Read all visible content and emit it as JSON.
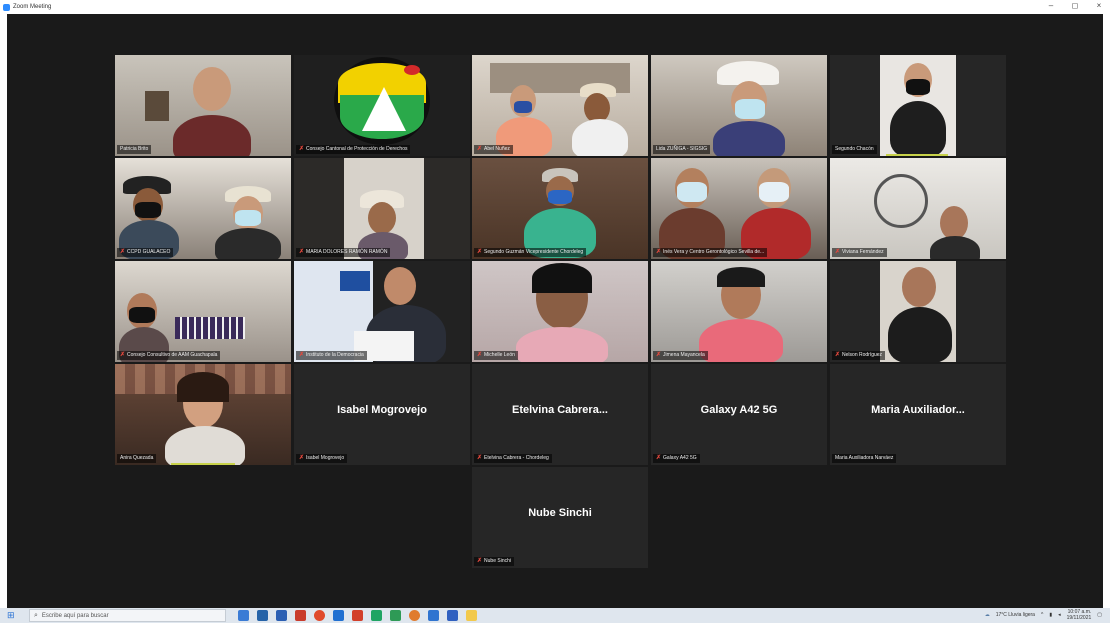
{
  "window": {
    "title": "Zoom Meeting",
    "controls": [
      "–",
      "◻",
      "×"
    ]
  },
  "participants": [
    {
      "name": "Patricia Brito",
      "muted": false
    },
    {
      "name": "Consejo Cantonal de Protección de Derechos",
      "muted": true
    },
    {
      "name": "Abel Nuñez",
      "muted": true
    },
    {
      "name": "Lida ZUÑIGA - SIGSIG",
      "muted": false
    },
    {
      "name": "Segundo Chacón",
      "muted": false
    },
    {
      "name": "CCPD GUALACEO",
      "muted": true
    },
    {
      "name": "MARIA DOLORES RAMÓN RAMÓN",
      "muted": true
    },
    {
      "name": "Segundo Guzmán Vicepresidente Chordeleg",
      "muted": true
    },
    {
      "name": "Inés Vera y Centro Gerontológico Sevilla de...",
      "muted": true
    },
    {
      "name": "Viviana Fernández",
      "muted": true
    },
    {
      "name": "Consejo Consultivo de AAM Guachapala",
      "muted": true
    },
    {
      "name": "Instituto de la Democracia",
      "muted": true
    },
    {
      "name": "Michelle León",
      "muted": true
    },
    {
      "name": "Jimena Mayancela",
      "muted": true
    },
    {
      "name": "Nelson Rodríguez",
      "muted": true
    },
    {
      "name": "Anira Quezada",
      "muted": false
    },
    {
      "name": "Isabel Mogrovejo",
      "display": "Isabel Mogrovejo",
      "muted": true
    },
    {
      "name": "Etelvina Cabrera - Chordeleg",
      "display": "Etelvina Cabrera...",
      "muted": true
    },
    {
      "name": "Galaxy A42 5G",
      "display": "Galaxy A42 5G",
      "muted": true
    },
    {
      "name": "Maria Auxiliadora Narváez",
      "display": "Maria  Auxiliador...",
      "muted": false
    },
    {
      "name": "Nube Sinchi",
      "display": "Nube Sinchi",
      "muted": true
    }
  ],
  "taskbar": {
    "search_placeholder": "Escribe aquí para buscar",
    "weather": "17°C  Lluvia ligera",
    "time": "10:07 a.m.",
    "date": "19/11/2021"
  },
  "colors": {
    "active_speaker": "#c8d24a",
    "muted_icon": "#e2483d",
    "meeting_bg": "#1a1a1a"
  }
}
